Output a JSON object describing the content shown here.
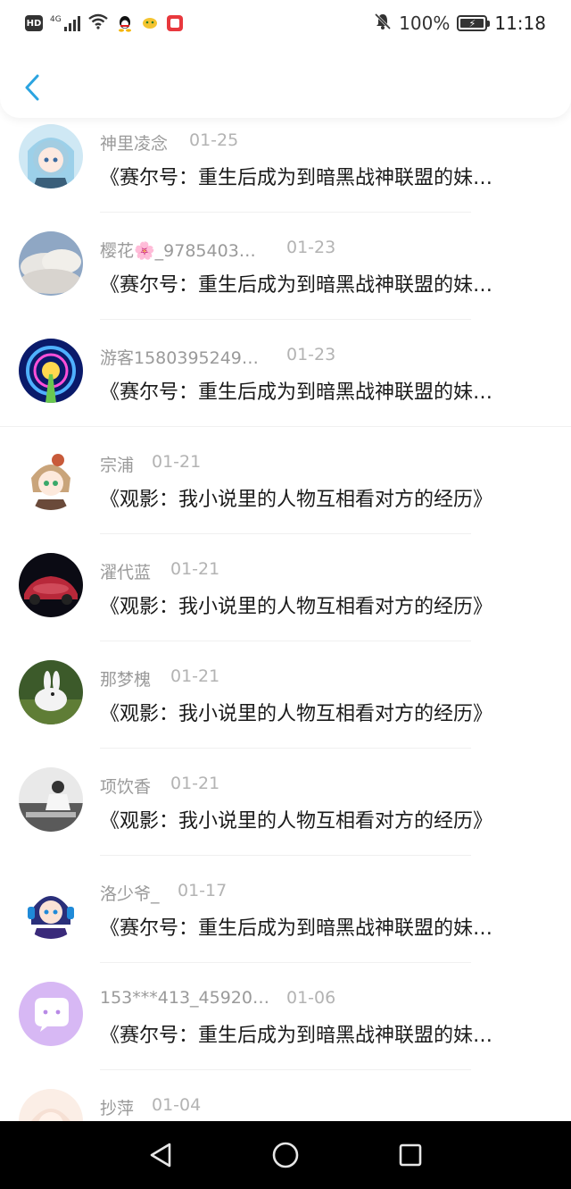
{
  "status_bar": {
    "hd": "HD",
    "network_gen": "4G",
    "battery_percent": "100%",
    "time": "11:18"
  },
  "header": {
    "back_icon": "chevron-left-icon",
    "accent_color": "#2ba4e0"
  },
  "list": [
    {
      "name": "神里凌念",
      "date": "01-25",
      "title": "《赛尔号：重生后成为到暗黑战神联盟的妹…"
    },
    {
      "name": "樱花🌸_9785403…",
      "date": "01-23",
      "title": "《赛尔号：重生后成为到暗黑战神联盟的妹…"
    },
    {
      "name": "游客1580395249…",
      "date": "01-23",
      "title": "《赛尔号：重生后成为到暗黑战神联盟的妹…"
    },
    {
      "name": "宗浦",
      "date": "01-21",
      "title": "《观影：我小说里的人物互相看对方的经历》"
    },
    {
      "name": "濯代蓝",
      "date": "01-21",
      "title": "《观影：我小说里的人物互相看对方的经历》"
    },
    {
      "name": "那梦槐",
      "date": "01-21",
      "title": "《观影：我小说里的人物互相看对方的经历》"
    },
    {
      "name": "项饮香",
      "date": "01-21",
      "title": "《观影：我小说里的人物互相看对方的经历》"
    },
    {
      "name": "洛少爷_",
      "date": "01-17",
      "title": "《赛尔号：重生后成为到暗黑战神联盟的妹…"
    },
    {
      "name": "153***413_45920…",
      "date": "01-06",
      "title": "《赛尔号：重生后成为到暗黑战神联盟的妹…"
    },
    {
      "name": "抄萍",
      "date": "01-04",
      "title": ""
    }
  ],
  "system_nav": {
    "back": "triangle-back-icon",
    "home": "circle-home-icon",
    "recents": "square-recents-icon"
  }
}
